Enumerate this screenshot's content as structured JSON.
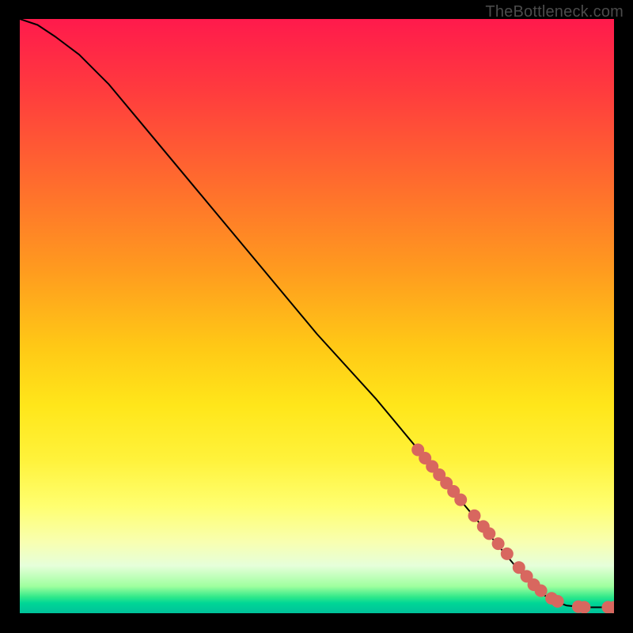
{
  "watermark": "TheBottleneck.com",
  "chart_data": {
    "type": "line",
    "title": "",
    "xlabel": "",
    "ylabel": "",
    "xlim": [
      0,
      100
    ],
    "ylim": [
      0,
      100
    ],
    "grid": false,
    "series": [
      {
        "name": "curve",
        "x": [
          0,
          3,
          6,
          10,
          15,
          20,
          30,
          40,
          50,
          60,
          70,
          80,
          85,
          88,
          90,
          92,
          94,
          96,
          98,
          100
        ],
        "y": [
          100,
          99,
          97,
          94,
          89,
          83,
          71,
          59,
          47,
          36,
          24,
          12,
          6,
          3.2,
          2.0,
          1.3,
          1.1,
          1.0,
          1.0,
          1.0
        ]
      }
    ],
    "scatter_points": {
      "name": "markers",
      "x": [
        67,
        68.2,
        69.4,
        70.6,
        71.8,
        73,
        74.2,
        76.5,
        78,
        79,
        80.5,
        82,
        84,
        85.3,
        86.5,
        87.7,
        89.5,
        90.5,
        94,
        95,
        99,
        100
      ],
      "y": [
        27.5,
        26.1,
        24.7,
        23.3,
        21.9,
        20.5,
        19.1,
        16.4,
        14.6,
        13.4,
        11.7,
        10.0,
        7.7,
        6.2,
        4.8,
        3.8,
        2.5,
        2.0,
        1.1,
        1.0,
        1.0,
        1.0
      ],
      "color": "#d8675f",
      "radius": 8
    }
  }
}
